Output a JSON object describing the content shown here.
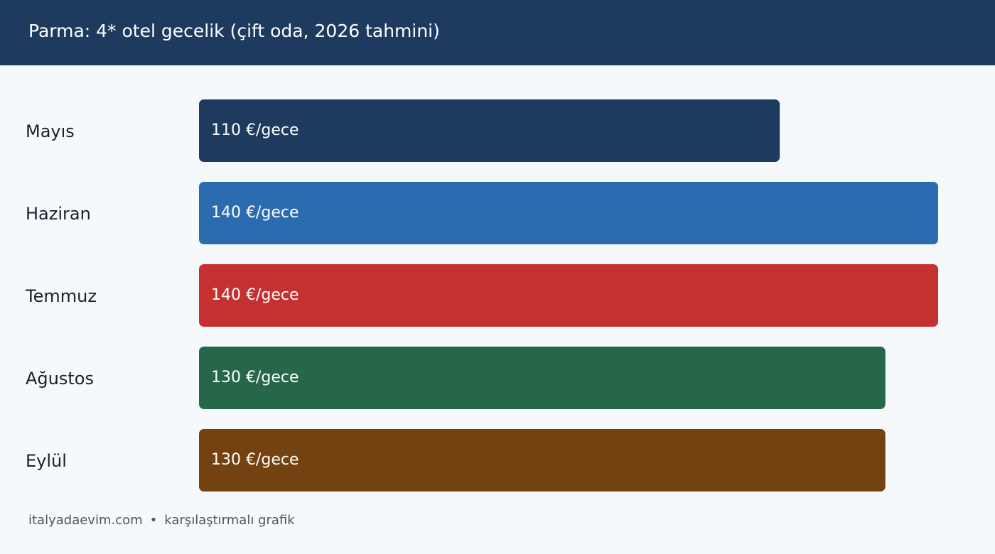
{
  "header": {
    "title": "Parma: 4* otel gecelik (çift oda, 2026 tahmini)"
  },
  "footer": {
    "site": "italyadaevim.com",
    "separator": "•",
    "caption": "karşılaştırmalı grafik"
  },
  "chart_data": {
    "type": "bar",
    "orientation": "horizontal",
    "title": "Parma: 4* otel gecelik (çift oda, 2026 tahmini)",
    "categories": [
      "Mayıs",
      "Haziran",
      "Temmuz",
      "Ağustos",
      "Eylül"
    ],
    "values": [
      110,
      140,
      140,
      130,
      130
    ],
    "value_labels": [
      "110 €/gece",
      "140 €/gece",
      "140 €/gece",
      "130 €/gece",
      "130 €/gece"
    ],
    "colors": [
      "#1f3a5f",
      "#2b6cb0",
      "#c53030",
      "#276749",
      "#744210"
    ],
    "unit": "€/gece",
    "xlim": [
      0,
      140
    ],
    "grid": false,
    "legend": false
  }
}
